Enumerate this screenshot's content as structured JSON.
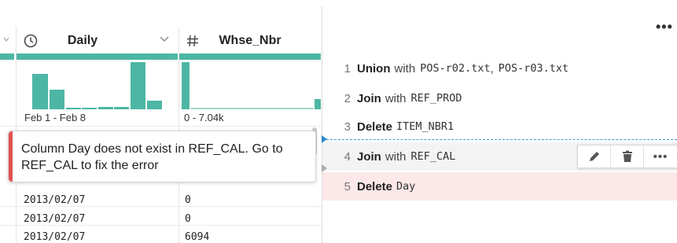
{
  "grid": {
    "columns": [
      {
        "name": "Daily",
        "icon": "clock-icon",
        "range_label": "Feb 1 - Feb 8"
      },
      {
        "name": "Whse_Nbr",
        "icon": "hash-icon",
        "range_label": "0 - 7.04k"
      }
    ],
    "rows": [
      {
        "daily": "2013/02/07",
        "whse": "0"
      },
      {
        "daily": "2013/02/07",
        "whse": "0"
      },
      {
        "daily": "2013/02/07",
        "whse": "6094"
      }
    ]
  },
  "error_tooltip": {
    "message": "Column Day does not exist in REF_CAL. Go to REF_CAL to fix the error"
  },
  "recipe": {
    "more_label": "•••",
    "steps": [
      {
        "num": "1",
        "keyword": "Union",
        "with": "with",
        "args": [
          "POS-r02.txt",
          "POS-r03.txt"
        ],
        "separator": ","
      },
      {
        "num": "2",
        "keyword": "Join",
        "with": "with",
        "args": [
          "REF_PROD"
        ]
      },
      {
        "num": "3",
        "keyword": "Delete",
        "args": [
          "ITEM_NBR1"
        ]
      },
      {
        "num": "4",
        "keyword": "Join",
        "with": "with",
        "args": [
          "REF_CAL"
        ]
      },
      {
        "num": "5",
        "keyword": "Delete",
        "args": [
          "Day"
        ]
      }
    ],
    "step_actions": {
      "edit_icon": "pencil-icon",
      "delete_icon": "trash-icon",
      "more_label": "•••"
    }
  },
  "colors": {
    "accent_teal": "#4db6a4",
    "error_red": "#e05252",
    "error_row_bg": "#fce8e8",
    "insert_line": "#3d9ad8"
  }
}
